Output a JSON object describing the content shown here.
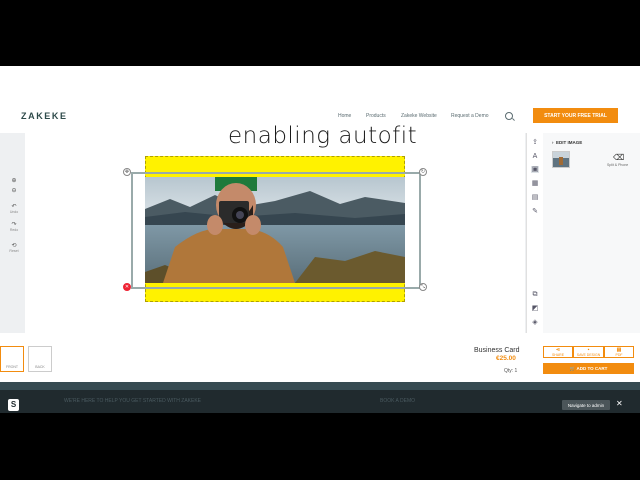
{
  "header": {
    "logo": "ZAKEKE",
    "nav": [
      "Home",
      "Products",
      "Zakeke Website",
      "Request a Demo"
    ],
    "trial_button": "START YOUR FREE TRIAL"
  },
  "left_tools": [
    {
      "icon": "zoom-in-icon",
      "glyph": "⊕",
      "label": ""
    },
    {
      "icon": "zoom-out-icon",
      "glyph": "⊖",
      "label": ""
    },
    {
      "icon": "undo-icon",
      "glyph": "↶",
      "label": "Undo"
    },
    {
      "icon": "redo-icon",
      "glyph": "↷",
      "label": "Redo"
    },
    {
      "icon": "reset-icon",
      "glyph": "⟲",
      "label": "Reset"
    }
  ],
  "canvas": {
    "text": "enabling autofit",
    "yellow_color": "#fff200"
  },
  "panel": {
    "title": "EDIT IMAGE",
    "remove_bg_label": "Split & Phone"
  },
  "product": {
    "sides": [
      "FRONT",
      "BACK"
    ],
    "name": "Business Card",
    "price": "€25.00",
    "qty": "Qty: 1",
    "buttons": [
      "SHARE",
      "SAVE DESIGN",
      "PDF"
    ],
    "cart_button": "ADD TO CART"
  },
  "footer": {
    "left_text": "WE'RE HERE TO HELP YOU GET STARTED WITH ZAKEKE",
    "right_text": "BOOK A DEMO",
    "admin_button": "Navigate to admin",
    "close_glyph": "✕",
    "shop_glyph": "S"
  },
  "colors": {
    "accent": "#f28c0f",
    "footer_bg": "#202a2e"
  }
}
